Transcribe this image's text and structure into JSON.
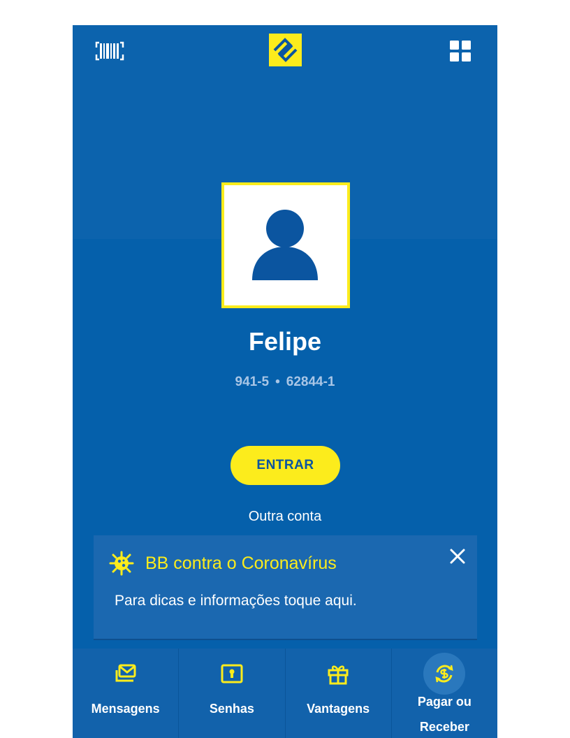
{
  "header": {
    "barcode_icon": "barcode-scanner-icon",
    "logo": "banco-do-brasil-logo",
    "apps_icon": "grid-apps-icon"
  },
  "profile": {
    "avatar_icon": "person-silhouette-icon",
    "name": "Felipe",
    "agency": "941-5",
    "separator": "•",
    "account": "62844-1"
  },
  "actions": {
    "enter_label": "ENTRAR",
    "other_account_label": "Outra conta"
  },
  "banner": {
    "icon": "virus-icon",
    "title": "BB contra o Coronavírus",
    "text": "Para dicas e informações toque aqui.",
    "close_icon": "close-icon"
  },
  "bottom_nav": {
    "items": [
      {
        "label": "Mensagens",
        "icon": "mail-stack-icon"
      },
      {
        "label": "Senhas",
        "icon": "keyhole-icon"
      },
      {
        "label": "Vantagens",
        "icon": "gift-icon"
      },
      {
        "label_line1": "Pagar ou",
        "label_line2": "Receber",
        "icon": "money-exchange-icon"
      }
    ]
  },
  "colors": {
    "brand_blue": "#0560ab",
    "brand_yellow": "#fcec1c",
    "banner_blue": "#1b68b0",
    "account_text": "#a9c6e6"
  }
}
